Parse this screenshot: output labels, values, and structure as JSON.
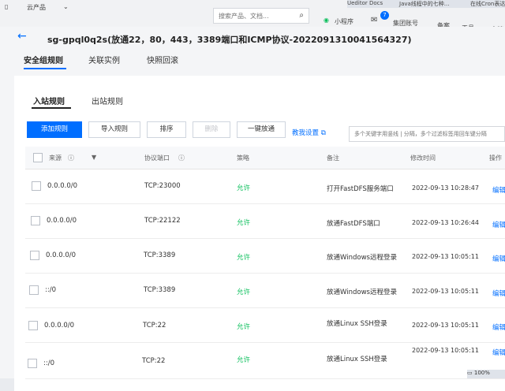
{
  "topnav": {
    "products": "云产品",
    "search_placeholder": "搜索产品、文档...",
    "miniprogram": "小程序",
    "notifications_count": "7",
    "account": "集团账号",
    "filing": "备案",
    "tools": "工具",
    "docs": "文档",
    "browser_tabs": [
      "Ueditor Docs",
      "Java线程中的七种...",
      "在线Cron表达式..."
    ]
  },
  "page": {
    "title": "sg-gpql0q2s(放通22，80，443，3389端口和ICMP协议-20220913100415643​27)",
    "tabs": [
      "安全组规则",
      "关联实例",
      "快照回滚"
    ]
  },
  "subtabs": [
    "入站规则",
    "出站规则"
  ],
  "toolbar": {
    "add": "添加规则",
    "import": "导入规则",
    "sort": "排序",
    "delete": "删除",
    "allow_all": "一键放通",
    "help": "教我设置",
    "search_placeholder": "多个关键字用竖线 | 分隔，多个过滤标签用回车键分隔"
  },
  "table": {
    "headers": [
      "来源",
      "协议端口",
      "策略",
      "备注",
      "修改时间",
      "操作"
    ],
    "rows": [
      {
        "source": "0.0.0.0/0",
        "port": "TCP:23000",
        "policy": "允许",
        "note": "打开FastDFS服务端口",
        "time": "2022-09-13 10:28:47",
        "action": "编辑"
      },
      {
        "source": "0.0.0.0/0",
        "port": "TCP:22122",
        "policy": "允许",
        "note": "放通FastDFS端口",
        "time": "2022-09-13 10:26:44",
        "action": "编辑"
      },
      {
        "source": "0.0.0.0/0",
        "port": "TCP:3389",
        "policy": "允许",
        "note": "放通Windows远程登录",
        "time": "2022-09-13 10:05:11",
        "action": "编辑"
      },
      {
        "source": "::/0",
        "port": "TCP:3389",
        "policy": "允许",
        "note": "放通Windows远程登录",
        "time": "2022-09-13 10:05:11",
        "action": "编辑"
      },
      {
        "source": "0.0.0.0/0",
        "port": "TCP:22",
        "policy": "允许",
        "note": "放通Linux SSH登录",
        "time": "2022-09-13 10:05:11",
        "action": "编辑"
      },
      {
        "source": "::/0",
        "port": "TCP:22",
        "policy": "允许",
        "note": "放通Linux SSH登录",
        "time": "2022-09-13 10:05:11",
        "action": "编辑"
      }
    ]
  },
  "status": {
    "battery": "100%"
  },
  "colors": {
    "accent": "#006eff",
    "allow": "#0abf5b"
  }
}
